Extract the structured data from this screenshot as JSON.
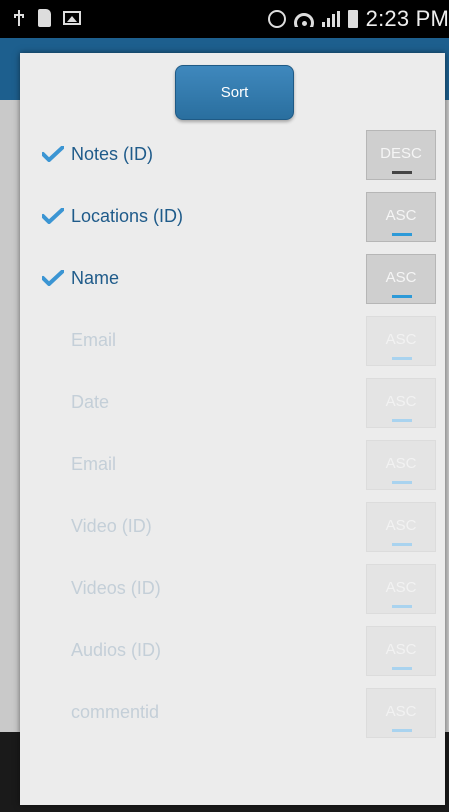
{
  "status_bar": {
    "time": "2:23 PM",
    "icons_left": [
      "usb-icon",
      "sd-card-icon",
      "image-icon"
    ],
    "icons_right": [
      "alarm-icon",
      "wifi-icon",
      "signal-icon",
      "battery-icon"
    ]
  },
  "dialog": {
    "sort_button_label": "Sort",
    "fields": [
      {
        "label": "Notes (ID)",
        "checked": true,
        "order": "DESC"
      },
      {
        "label": "Locations (ID)",
        "checked": true,
        "order": "ASC"
      },
      {
        "label": "Name",
        "checked": true,
        "order": "ASC"
      },
      {
        "label": "Email",
        "checked": false,
        "order": "ASC"
      },
      {
        "label": "Date",
        "checked": false,
        "order": "ASC"
      },
      {
        "label": "Email",
        "checked": false,
        "order": "ASC"
      },
      {
        "label": "Video (ID)",
        "checked": false,
        "order": "ASC"
      },
      {
        "label": "Videos (ID)",
        "checked": false,
        "order": "ASC"
      },
      {
        "label": "Audios (ID)",
        "checked": false,
        "order": "ASC"
      },
      {
        "label": "commentid",
        "checked": false,
        "order": "ASC"
      }
    ]
  },
  "colors": {
    "accent": "#3f88bd",
    "label_active": "#1f5b8a",
    "label_inactive": "#c4cfd8",
    "check": "#3b95d3"
  }
}
